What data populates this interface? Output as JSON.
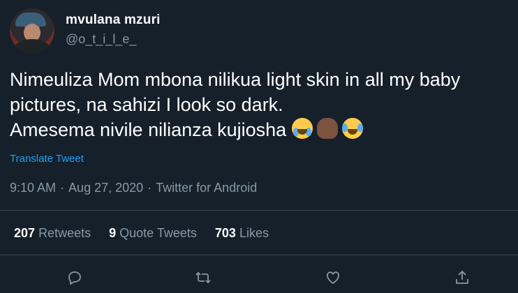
{
  "user": {
    "display_name": "mvulana mzuri",
    "handle": "@o_t_i_l_e_"
  },
  "tweet": {
    "line1": "Nimeuliza Mom mbona nilikua light skin in all my baby",
    "line2": "pictures, na sahizi I look so dark.",
    "line3": "Amesema nivile nilianza kujiosha",
    "emojis": [
      "loudly-crying-face",
      "person-facepalming",
      "face-with-tears-of-joy"
    ],
    "translate": "Translate Tweet"
  },
  "meta": {
    "time": "9:10 AM",
    "sep1": "·",
    "date": "Aug 27, 2020",
    "sep2": "·",
    "source": "Twitter for Android"
  },
  "stats": {
    "retweets_count": "207",
    "retweets_label": "Retweets",
    "quotes_count": "9",
    "quotes_label": "Quote Tweets",
    "likes_count": "703",
    "likes_label": "Likes"
  },
  "actions": [
    "reply-icon",
    "retweet-icon",
    "like-icon",
    "share-icon"
  ],
  "colors": {
    "background": "#15202b",
    "text": "#ffffff",
    "secondary": "#8899a6",
    "link": "#1da1f2",
    "divider": "#38444d"
  }
}
